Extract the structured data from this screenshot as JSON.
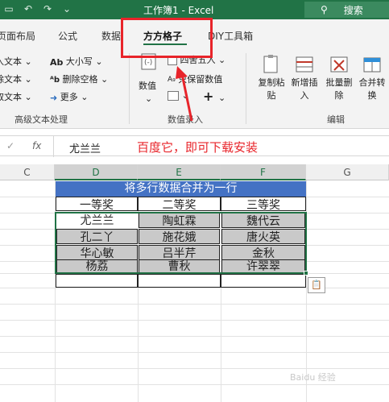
{
  "window": {
    "title": "工作簿1 - Excel",
    "search_label": "搜索",
    "qat_icons": [
      "save-icon",
      "undo-icon",
      "redo-icon",
      "customize-icon"
    ]
  },
  "tabs": [
    {
      "label": "页面布局"
    },
    {
      "label": "公式"
    },
    {
      "label": "数据"
    },
    {
      "label": "方方格子",
      "active": true
    },
    {
      "label": "DIY工具箱"
    }
  ],
  "ribbon": {
    "text_group": {
      "buttons": [
        "入文本",
        "除文本",
        "取文本",
        "大小写",
        "删除空格",
        "更多"
      ],
      "label": "高级文本处理"
    },
    "numeric_group": {
      "buttons": [
        "数值",
        "四舍五入",
        "只保留数值"
      ],
      "label": "数值录入"
    },
    "edit_group": {
      "buttons": [
        {
          "line1": "复制粘",
          "line2": "贴"
        },
        {
          "line1": "新增插",
          "line2": "入"
        },
        {
          "line1": "批量删",
          "line2": "除"
        },
        {
          "line1": "合并转",
          "line2": "换"
        }
      ],
      "label": "编辑"
    }
  },
  "formula_bar": {
    "cancel_glyph": "✓",
    "fx_label": "fx",
    "value": "尤兰兰",
    "annotation": "百度它，即可下载安装"
  },
  "sheet": {
    "columns": [
      "C",
      "D",
      "E",
      "F",
      "G"
    ],
    "merged_title": "将多行数据合并为一行",
    "header_row": [
      "一等奖",
      "二等奖",
      "三等奖"
    ],
    "rows": [
      [
        "尤兰兰",
        "陶虹霖",
        "魏代云"
      ],
      [
        "孔二丫",
        "施花娥",
        "唐火英"
      ],
      [
        "华心敏",
        "吕半芹",
        "金秋"
      ],
      [
        "杨荔",
        "曹秋",
        "许翠翠"
      ]
    ],
    "paste_options_icon": "paste-options-icon"
  },
  "watermark": "Baidu 经验",
  "colors": {
    "title_bar": "#217346",
    "highlight": "#e8242a",
    "merged_title_bg": "#4472c4",
    "data_cell_bg": "#c9c9c9"
  }
}
